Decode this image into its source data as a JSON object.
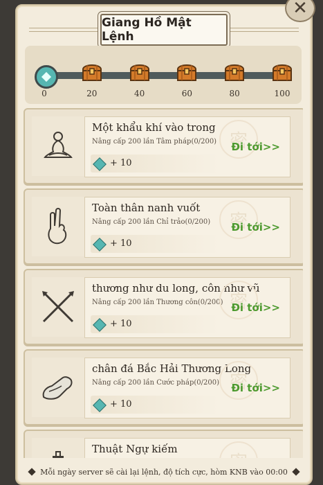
{
  "title": "Giang Hồ Mật Lệnh",
  "close": "✕",
  "progress": {
    "value": 0,
    "milestones": [
      "0",
      "20",
      "40",
      "60",
      "80",
      "100"
    ],
    "chest_icon": "treasure-chest-icon",
    "start_icon": "gem-icon"
  },
  "tasks": [
    {
      "name": "Một khẩu khí vào trong",
      "req": "Nâng cấp 200 lần Tâm pháp(0/200)",
      "reward": "+ 10",
      "goto": "Đi tới>>",
      "icon": "meditation-icon"
    },
    {
      "name": "Toàn thân nanh vuốt",
      "req": "Nâng cấp 200 lần Chỉ trảo(0/200)",
      "reward": "+ 10",
      "goto": "Đi tới>>",
      "icon": "finger-gesture-icon"
    },
    {
      "name": "thương như du long, côn như vũ",
      "req": "Nâng cấp 200 lần Thương côn(0/200)",
      "reward": "+ 10",
      "goto": "Đi tới>>",
      "icon": "crossed-spears-icon"
    },
    {
      "name": "chân đá Bắc Hải Thương Long",
      "req": "Nâng cấp 200 lần Cước pháp(0/200)",
      "reward": "+ 10",
      "goto": "Đi tới>>",
      "icon": "boot-icon"
    },
    {
      "name": "Thuật Ngự kiếm",
      "req": "",
      "reward": "",
      "goto": "",
      "icon": "sword-icon"
    }
  ],
  "footer": "Mỗi ngày server sẽ cài lại lệnh, độ tích cực, hòm KNB vào 00:00",
  "colors": {
    "goto": "#4d9a2f",
    "gem": "#56b6b1",
    "panel": "#f3ecdd"
  }
}
